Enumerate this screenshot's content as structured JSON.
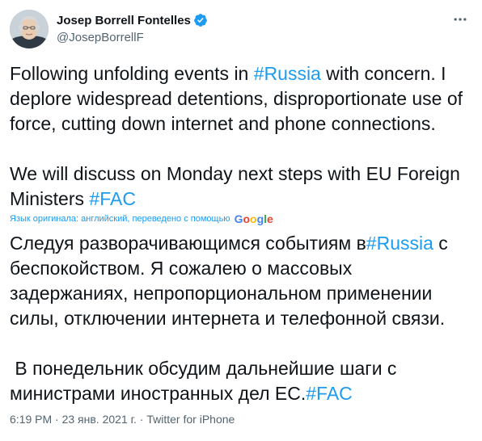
{
  "author": {
    "display_name": "Josep Borrell Fontelles",
    "handle": "@JosepBorrellF",
    "verified_icon": "verified-badge-icon",
    "avatar_icon": "profile-photo"
  },
  "tweet": {
    "line1_pre": "Following unfolding events in ",
    "line1_tag": "#Russia",
    "line1_post": " with concern. I deplore widespread detentions, disproportionate use of force, cutting down internet and phone connections.",
    "line2_pre": "We will discuss on Monday next steps with EU Foreign Ministers ",
    "line2_tag": "#FAC"
  },
  "translation": {
    "notice": "Язык оригинала: английский, переведено с помощью",
    "provider": "Google",
    "provider_colors": [
      "#4285F4",
      "#EA4335",
      "#FBBC05",
      "#4285F4",
      "#34A853",
      "#EA4335"
    ],
    "t1_pre": "Следуя разворачивающимся событиям в",
    "t1_tag": "#Russia",
    "t1_post": " с беспокойством. Я сожалею о массовых задержаниях, непропорциональном применении силы, отключении интернета и телефонной связи.",
    "t2_pre": " В понедельник обсудим дальнейшие шаги с министрами иностранных дел ЕС.",
    "t2_tag": "#FAC"
  },
  "meta": {
    "time": "6:19 PM",
    "separator": "·",
    "date": "23 янв. 2021 г.",
    "source": "Twitter for iPhone"
  },
  "colors": {
    "accent": "#1d9bf0",
    "text": "#0f1419",
    "secondary": "#536471"
  }
}
